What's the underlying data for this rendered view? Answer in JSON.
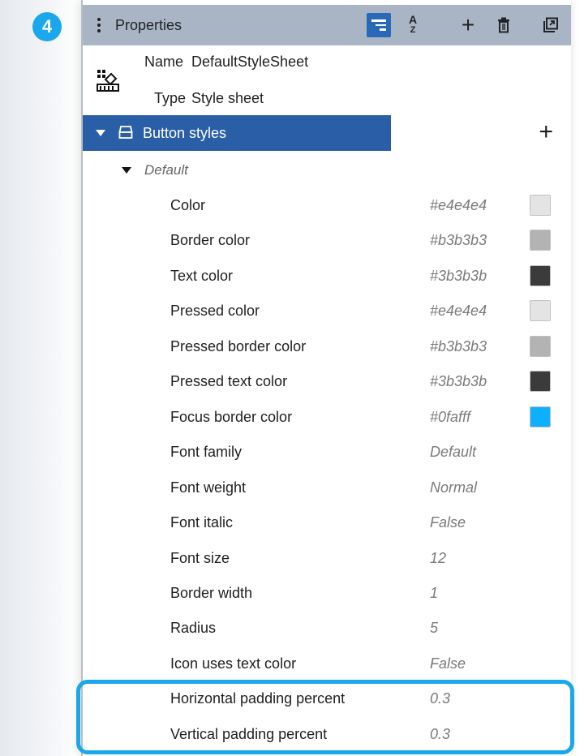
{
  "step_badge": "4",
  "header": {
    "title": "Properties",
    "az_top": "A",
    "az_bottom": "Z"
  },
  "meta": {
    "name_label": "Name",
    "name_value": "DefaultStyleSheet",
    "type_label": "Type",
    "type_value": "Style sheet"
  },
  "group": {
    "label": "Button styles",
    "subgroup": "Default"
  },
  "properties": [
    {
      "name": "Color",
      "value": "#e4e4e4",
      "swatch": "#e4e4e4"
    },
    {
      "name": "Border color",
      "value": "#b3b3b3",
      "swatch": "#b3b3b3"
    },
    {
      "name": "Text color",
      "value": "#3b3b3b",
      "swatch": "#3b3b3b"
    },
    {
      "name": "Pressed color",
      "value": "#e4e4e4",
      "swatch": "#e4e4e4"
    },
    {
      "name": "Pressed border color",
      "value": "#b3b3b3",
      "swatch": "#b3b3b3"
    },
    {
      "name": "Pressed text color",
      "value": "#3b3b3b",
      "swatch": "#3b3b3b"
    },
    {
      "name": "Focus border color",
      "value": "#0fafff",
      "swatch": "#0fafff"
    },
    {
      "name": "Font family",
      "value": "Default"
    },
    {
      "name": "Font weight",
      "value": "Normal"
    },
    {
      "name": "Font italic",
      "value": "False"
    },
    {
      "name": "Font size",
      "value": "12"
    },
    {
      "name": "Border width",
      "value": "1"
    },
    {
      "name": "Radius",
      "value": "5"
    },
    {
      "name": "Icon uses text color",
      "value": "False"
    },
    {
      "name": "Horizontal padding percent",
      "value": "0.3"
    },
    {
      "name": "Vertical padding percent",
      "value": "0.3"
    }
  ],
  "colors": {
    "header_bg": "#a9b5c4",
    "active_button": "#2a69b7",
    "group_row": "#2a5fa8",
    "highlight": "#1aa7ec"
  }
}
